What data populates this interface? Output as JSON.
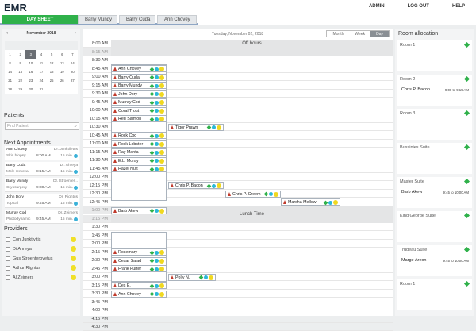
{
  "app": {
    "title": "EMR",
    "nav": [
      "ADMIN",
      "LOG OUT",
      "HELP"
    ]
  },
  "tabs": [
    "DAY SHEET",
    "Barry Mundy",
    "Barry Cuda",
    "Ann Chovey"
  ],
  "calendar": {
    "month": "November 2018",
    "prev": "‹",
    "next": "›",
    "headers": [
      "",
      "",
      "",
      "",
      "",
      "",
      ""
    ],
    "weeks": [
      [
        "1",
        "2",
        "3",
        "4",
        "5",
        "6",
        "7"
      ],
      [
        "8",
        "9",
        "10",
        "11",
        "12",
        "13",
        "14"
      ],
      [
        "14",
        "15",
        "16",
        "17",
        "18",
        "19",
        "20"
      ],
      [
        "21",
        "22",
        "23",
        "24",
        "25",
        "26",
        "27"
      ],
      [
        "28",
        "29",
        "30",
        "31",
        "",
        "",
        ""
      ]
    ],
    "selected": "3"
  },
  "patients": {
    "title": "Patients",
    "placeholder": "Find Patient"
  },
  "next_appointments": {
    "title": "Next Appointments",
    "items": [
      {
        "name": "Ann Chovey",
        "doctor": "Dr. Junktiletus",
        "type": "Skin biopsy",
        "time": "8:00 AM",
        "duration": "15 min."
      },
      {
        "name": "Barry Cuda",
        "doctor": "Dr. Ahreya",
        "type": "Mole removal",
        "time": "8:15 AM",
        "duration": "15 min."
      },
      {
        "name": "Barry Mundy",
        "doctor": "Dr. Stroenter...",
        "type": "Cryosurgery",
        "time": "9:30 AM",
        "duration": "15 min."
      },
      {
        "name": "John Dory",
        "doctor": "Dr. Rightus",
        "type": "Topical",
        "time": "9:45 AM",
        "duration": "15 min."
      },
      {
        "name": "Murray Cod",
        "doctor": "Dr. Zeimers",
        "type": "Photodynamic",
        "time": "9:45 AM",
        "duration": "15 min."
      }
    ]
  },
  "providers": {
    "title": "Providers",
    "items": [
      "Con Junktivitis",
      "Di Ahreya",
      "Gus Stroenteroyetus",
      "Arthur Rightus",
      "Al Zeimers"
    ]
  },
  "center": {
    "date": "Tuesday, November 02, 2018",
    "views": [
      "Month",
      "Week",
      "Day"
    ],
    "active_view": "Day",
    "off_hours": "Off hours",
    "lunch": "Lunch Time",
    "times": [
      "8:00 AM",
      "8:15 AM",
      "8:30 AM",
      "8:45 AM",
      "9:00 AM",
      "9:15 AM",
      "9:30 AM",
      "9:45 AM",
      "10:00 AM",
      "10:15 AM",
      "10:30 AM",
      "10:45 AM",
      "11:00 AM",
      "11:15 AM",
      "11:30 AM",
      "11:45 AM",
      "12:00 PM",
      "12:15 PM",
      "12:30 PM",
      "12:45 PM",
      "1:00 PM",
      "1:15 PM",
      "1:30 PM",
      "1:45 PM",
      "2:00 PM",
      "2:15 PM",
      "2:30 PM",
      "2:45 PM",
      "3:00 PM",
      "3:15 PM",
      "3:30 PM",
      "3:45 PM",
      "4:00 PM",
      "4:15 PM",
      "4:30 PM"
    ],
    "appointments": [
      "Ann Chovey",
      "Barry Cuda",
      "Barry Mundy",
      "John Dory",
      "Murray Cod",
      "Coral Trout",
      "Red Salmon",
      "Tigor Prawn",
      "Rock Cod",
      "Rock Lobster",
      "Ray Manta",
      "E.L. Moray",
      "Hazel Nutt",
      "Chris P. Bacon",
      "Chris P. Creem",
      "Marsha Mellow",
      "Barb Akew",
      "Rosemary",
      "Cesar Salad",
      "Frank Furter",
      "Polly N.",
      "Des E.",
      "Ann Chovey"
    ]
  },
  "rooms": {
    "title": "Room allocation",
    "items": [
      {
        "name": "Room 1",
        "patient": "",
        "time": ""
      },
      {
        "name": "Room 2",
        "patient": "Chris P. Bacon",
        "time": "9:00 to 9:15 AM"
      },
      {
        "name": "Room 3",
        "patient": "",
        "time": ""
      },
      {
        "name": "Bussinies Suite",
        "patient": "",
        "time": ""
      },
      {
        "name": "Master Suite",
        "patient": "Barb Akew",
        "time": "9:45 to 10:00 AM"
      },
      {
        "name": "King George Suite",
        "patient": "",
        "time": ""
      },
      {
        "name": "Trudeau Suite",
        "patient": "Marge Areon",
        "time": "9:45 to 10:00 AM"
      },
      {
        "name": "Room 1",
        "patient": "",
        "time": ""
      }
    ]
  }
}
